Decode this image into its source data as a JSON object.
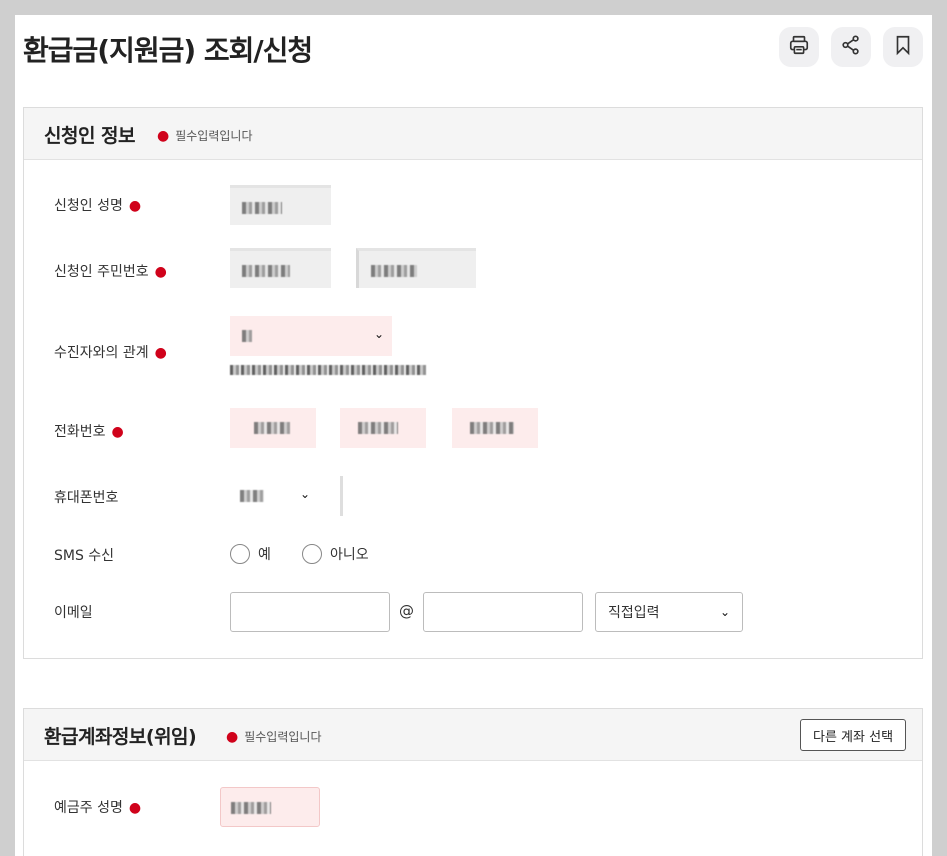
{
  "page": {
    "title": "환급금(지원금) 조회/신청"
  },
  "toolbar": {
    "print_icon": "printer-icon",
    "share_icon": "share-icon",
    "bookmark_icon": "bookmark-icon"
  },
  "applicant": {
    "title": "신청인 정보",
    "required_note": "필수입력입니다",
    "fields": {
      "name_label": "신청인 성명",
      "rrn_label": "신청인 주민번호",
      "relation_label": "수진자와의 관계",
      "phone_label": "전화번호",
      "mobile_label": "휴대폰번호",
      "sms_label": "SMS 수신",
      "email_label": "이메일"
    },
    "sms_options": [
      "예",
      "아니오"
    ],
    "email": {
      "at": "@",
      "domain_select": "직접입력"
    }
  },
  "refund_account": {
    "title": "환급계좌정보(위임)",
    "required_note": "필수입력입니다",
    "other_account_button": "다른 계좌 선택",
    "holder_label": "예금주 성명"
  },
  "colors": {
    "required": "#d0021b",
    "section_bg": "#f5f5f5",
    "error_field_bg": "#fdecec",
    "readonly_field_bg": "#efefef"
  }
}
